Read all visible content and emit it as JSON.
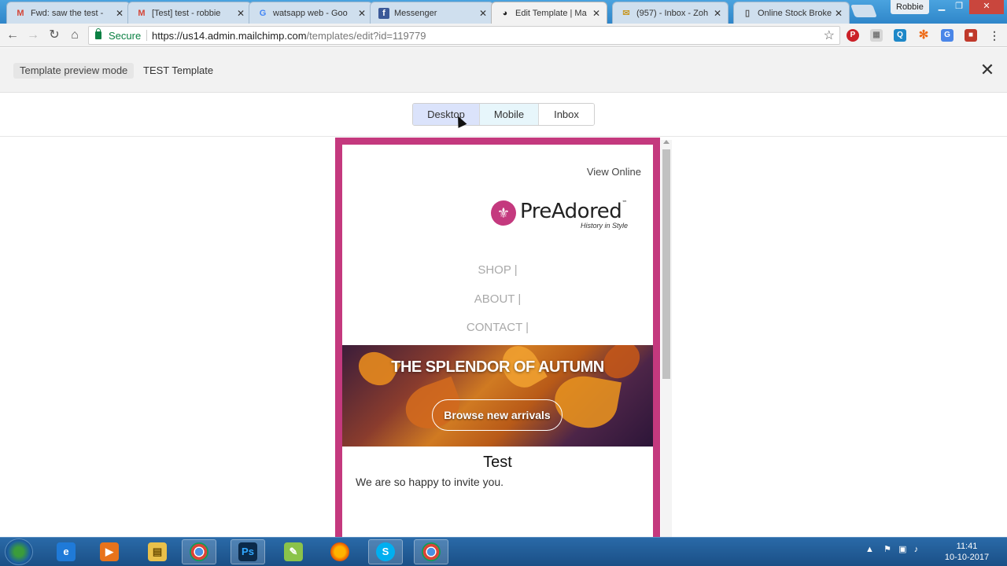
{
  "browser": {
    "tabs": [
      {
        "title": "Fwd: saw the test -",
        "icon": "gmail-icon",
        "active": false
      },
      {
        "title": "[Test] test - robbie",
        "icon": "gmail-icon",
        "active": false
      },
      {
        "title": "watsapp web - Goo",
        "icon": "google-icon",
        "active": false
      },
      {
        "title": "Messenger",
        "icon": "facebook-icon",
        "active": false
      },
      {
        "title": "Edit Template | Ma",
        "icon": "mailchimp-icon",
        "active": true
      },
      {
        "title": "(957) - Inbox - Zoh",
        "icon": "zoho-icon",
        "active": false
      },
      {
        "title": "Online Stock Broke",
        "icon": "page-icon",
        "active": false
      }
    ],
    "profile_name": "Robbie",
    "secure_label": "Secure",
    "url_host": "https://us14.admin.mailchimp.com",
    "url_path": "/templates/edit?id=119779",
    "colors": {
      "secure_green": "#0b8043",
      "brand_pink": "#c4397e"
    }
  },
  "preview": {
    "mode_label": "Template preview mode",
    "template_name": "TEST Template",
    "devices": [
      "Desktop",
      "Mobile",
      "Inbox"
    ],
    "selected_device": "Desktop"
  },
  "email": {
    "view_online": "View Online",
    "logo_text": "PreAdored",
    "logo_trademark": "™",
    "logo_tagline": "History in Style",
    "menu": [
      "SHOP |",
      "ABOUT |",
      "CONTACT |"
    ],
    "banner_title": "THE SPLENDOR OF AUTUMN",
    "banner_button": "Browse new arrivals",
    "heading": "Test",
    "body": "We are so happy to invite you."
  },
  "taskbar": {
    "apps": [
      "internet-explorer-icon",
      "media-player-icon",
      "explorer-icon",
      "chrome-icon",
      "photoshop-icon",
      "notepad-icon",
      "firefox-icon",
      "skype-icon",
      "chrome-icon"
    ],
    "time": "11:41",
    "date": "10-10-2017"
  }
}
